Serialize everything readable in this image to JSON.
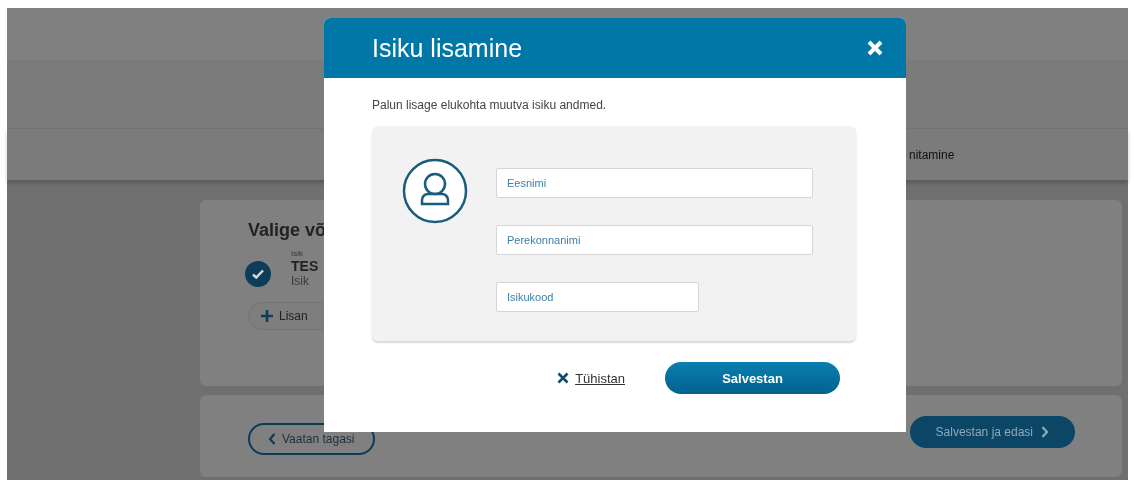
{
  "page": {
    "step_label": "nitamine",
    "card": {
      "title": "Valige võ",
      "person": {
        "label": "Isik",
        "name": "TES",
        "sub": "Isik",
        "checked": true
      },
      "add_button": "Lisan"
    },
    "back_button": "Vaatan tagasi",
    "next_button": "Salvestan ja edasi"
  },
  "dialog": {
    "title": "Isiku lisamine",
    "intro": "Palun lisage elukohta muutva isiku andmed.",
    "fields": [
      {
        "placeholder": "Eesnimi",
        "kind": "wide"
      },
      {
        "placeholder": "Perekonnanimi",
        "kind": "wide"
      },
      {
        "placeholder": "Isikukood",
        "kind": "short"
      }
    ],
    "cancel": "Tühistan",
    "save": "Salvestan"
  }
}
